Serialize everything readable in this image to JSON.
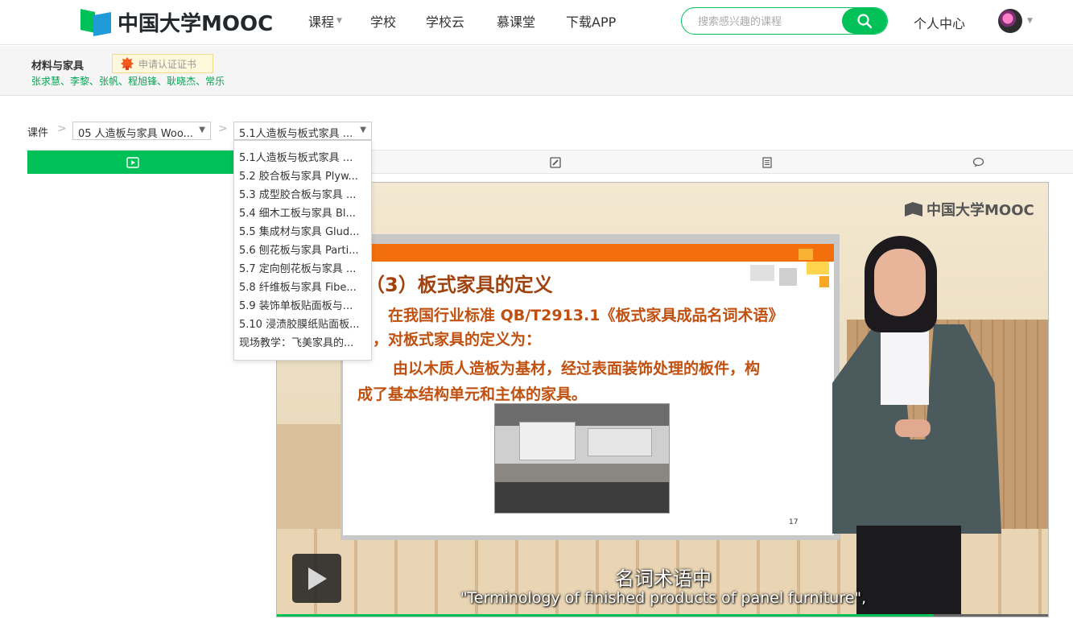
{
  "header": {
    "logo_text": "中国大学MOOC",
    "nav": [
      {
        "label": "课程",
        "has_dropdown": true
      },
      {
        "label": "学校"
      },
      {
        "label": "学校云"
      },
      {
        "label": "慕课堂"
      },
      {
        "label": "下载APP"
      }
    ],
    "search_placeholder": "搜索感兴趣的课程",
    "personal_center": "个人中心"
  },
  "course": {
    "title": "材料与家具",
    "cert_label": "申请认证证书",
    "teachers": [
      "张求慧",
      "李黎",
      "张帆",
      "程旭锋",
      "耿晓杰",
      "常乐"
    ],
    "separator": "、"
  },
  "breadcrumb": {
    "label": "课件",
    "chapter": "05 人造板与家具 Woo...",
    "lesson": "5.1人造板与板式家具 ..."
  },
  "tabs": [
    {
      "icon": "video-icon",
      "active": true
    },
    {
      "icon": "quiz-icon"
    },
    {
      "icon": "document-icon"
    },
    {
      "icon": "discussion-icon"
    }
  ],
  "dropdown": {
    "items": [
      "5.1人造板与板式家具 ...",
      "5.2 胶合板与家具  Plyw...",
      "5.3 成型胶合板与家具  ...",
      "5.4 细木工板与家具  Bl...",
      "5.5 集成材与家具  Glud...",
      "5.6 刨花板与家具  Parti...",
      "5.7 定向刨花板与家具  ...",
      "5.8 纤维板与家具  Fibe...",
      "5.9 装饰单板贴面板与...",
      "5.10 浸渍胶膜纸贴面板...",
      "现场教学：飞美家具的..."
    ]
  },
  "video": {
    "watermark": "中国大学MOOC",
    "slide": {
      "title": "（3）板式家具的定义",
      "line1": "在我国行业标准 QB/T2913.1《板式家具成品名词术语》",
      "line2": "中，对板式家具的定义为：",
      "line3": "由以木质人造板为基材，经过表面装饰处理的板件，构",
      "line4": "成了基本结构单元和主体的家具。",
      "page_number": "17"
    },
    "subtitle_cn": "名词术语中",
    "subtitle_en": "\"Terminology of finished products of panel furniture\",",
    "progress": 0.85
  },
  "colors": {
    "brand_green": "#00c058",
    "teacher_green": "#00a651",
    "slide_orange": "#f36f0c",
    "slide_text": "#c0500f"
  }
}
